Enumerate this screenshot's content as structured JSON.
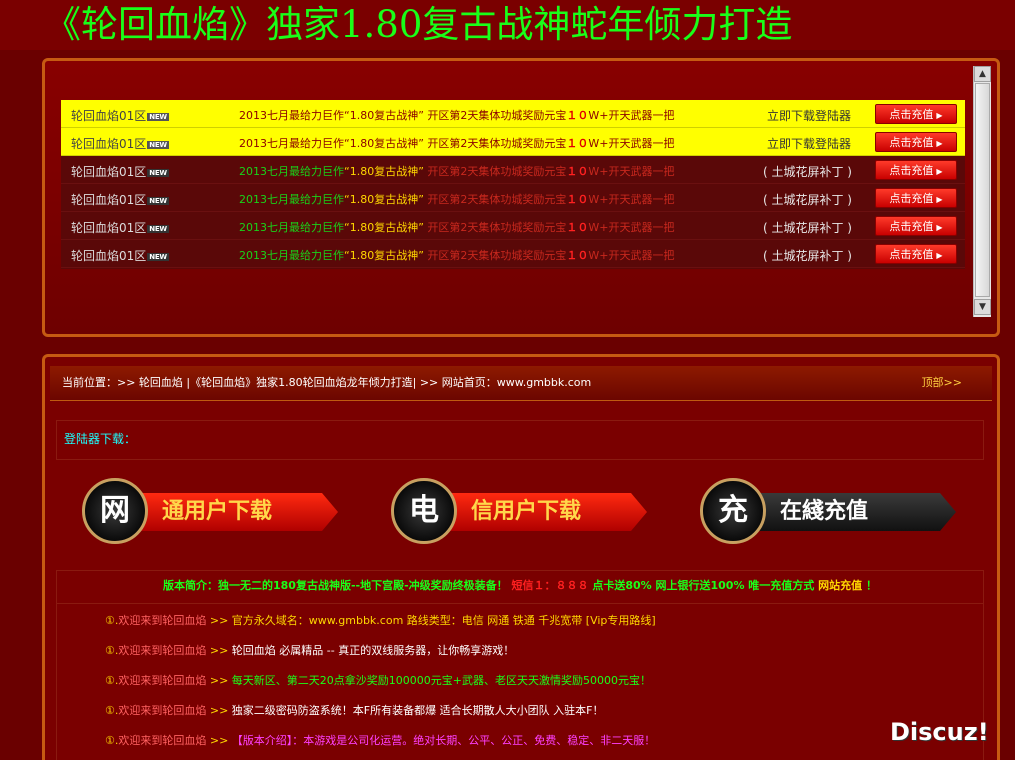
{
  "headline": "《轮回血焰》独家1.80复古战神蛇年倾力打造",
  "servers": [
    {
      "name": "轮回血焰01区",
      "badge": "NEW",
      "desc_prefix": "2013七月最给力巨作",
      "desc_quote": "“1.80复古战神”",
      "desc_mid": "开区第2天集体功城奖励元宝",
      "desc_amount": "１０",
      "desc_suffix": "W+开天武器一把",
      "line": "立即下载登陆器",
      "button": "点击充值",
      "highlight": true
    },
    {
      "name": "轮回血焰01区",
      "badge": "NEW",
      "desc_prefix": "2013七月最给力巨作",
      "desc_quote": "“1.80复古战神”",
      "desc_mid": "开区第2天集体功城奖励元宝",
      "desc_amount": "１０",
      "desc_suffix": "W+开天武器一把",
      "line": "立即下载登陆器",
      "button": "点击充值",
      "highlight": true
    },
    {
      "name": "轮回血焰01区",
      "badge": "NEW",
      "desc_prefix": "2013七月最给力巨作",
      "desc_quote": "“1.80复古战神”",
      "desc_mid": "开区第2天集体功城奖励元宝",
      "desc_amount": "１０",
      "desc_suffix": "W+开天武器一把",
      "line": "( 土城花屏补丁 )",
      "button": "点击充值",
      "highlight": false
    },
    {
      "name": "轮回血焰01区",
      "badge": "NEW",
      "desc_prefix": "2013七月最给力巨作",
      "desc_quote": "“1.80复古战神”",
      "desc_mid": "开区第2天集体功城奖励元宝",
      "desc_amount": "１０",
      "desc_suffix": "W+开天武器一把",
      "line": "( 土城花屏补丁 )",
      "button": "点击充值",
      "highlight": false
    },
    {
      "name": "轮回血焰01区",
      "badge": "NEW",
      "desc_prefix": "2013七月最给力巨作",
      "desc_quote": "“1.80复古战神”",
      "desc_mid": "开区第2天集体功城奖励元宝",
      "desc_amount": "１０",
      "desc_suffix": "W+开天武器一把",
      "line": "( 土城花屏补丁 )",
      "button": "点击充值",
      "highlight": false
    },
    {
      "name": "轮回血焰01区",
      "badge": "NEW",
      "desc_prefix": "2013七月最给力巨作",
      "desc_quote": "“1.80复古战神”",
      "desc_mid": "开区第2天集体功城奖励元宝",
      "desc_amount": "１０",
      "desc_suffix": "W+开天武器一把",
      "line": "( 土城花屏补丁 )",
      "button": "点击充值",
      "highlight": false
    }
  ],
  "breadcrumb": {
    "text": "当前位置：>> 轮回血焰 |《轮回血焰》独家1.80轮回血焰龙年倾力打造| >> 网站首页：www.gmbbk.com",
    "top_link": "顶部>>"
  },
  "launcher_label": "登陆器下载：",
  "download_buttons": [
    {
      "icon_char": "网",
      "label": "通用户下载",
      "style": "red"
    },
    {
      "icon_char": "电",
      "label": "信用户下载",
      "style": "red"
    },
    {
      "icon_char": "充",
      "label": "在綫充值",
      "style": "dark"
    }
  ],
  "summary": {
    "part1": "版本简介：独一无二的180复古战神版--地下宫殿-冲级奖励终极装备！",
    "part2": "短信１：８８８",
    "part3": "点卡送80% 网上银行送100% 唯一充值方式",
    "part4": "网站充值",
    "part5": "！"
  },
  "notices": [
    {
      "bullet": "①.",
      "welcome": "欢迎来到轮回血焰",
      "arrow": ">>",
      "text": "官方永久域名：www.gmbbk.com 路线类型：电信 网通 铁通 千兆宽带 [Vip专用路线]",
      "color": "#ffd700"
    },
    {
      "bullet": "①.",
      "welcome": "欢迎来到轮回血焰",
      "arrow": ">>",
      "text": "轮回血焰 必属精品 -- 真正的双线服务器，让你畅享游戏！",
      "color": "#ffffff"
    },
    {
      "bullet": "①.",
      "welcome": "欢迎来到轮回血焰",
      "arrow": ">>",
      "text": "每天新区、第二天20点拿沙奖励100000元宝+武器、老区天天激情奖励50000元宝！",
      "color": "#19ff19"
    },
    {
      "bullet": "①.",
      "welcome": "欢迎来到轮回血焰",
      "arrow": ">>",
      "text": "独家二级密码防盗系统！本F所有装备都爆 适合长期散人大小团队 入驻本F！",
      "color": "#ffffff"
    },
    {
      "bullet": "①.",
      "welcome": "欢迎来到轮回血焰",
      "arrow": ">>",
      "text": "【版本介绍】：本游戏是公司化运营。绝对长期、公平、公正、免费、稳定、非二天服！",
      "color": "#ff40ff"
    }
  ],
  "watermark": "Discuz!"
}
